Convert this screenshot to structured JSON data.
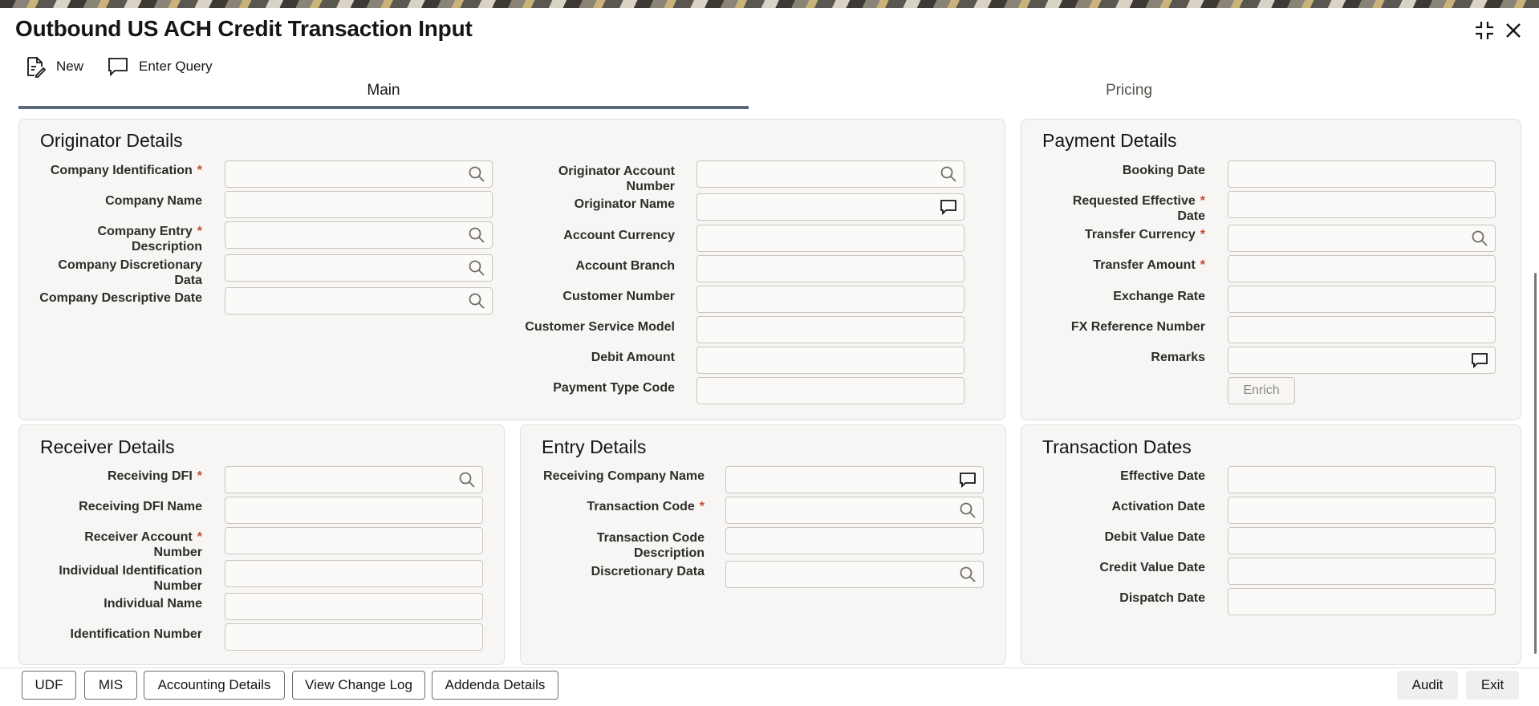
{
  "window": {
    "title": "Outbound US ACH Credit Transaction Input",
    "maximize_icon": "collapse-arrows-icon",
    "close_icon": "close-icon"
  },
  "toolbar": {
    "new_label": "New",
    "enter_query_label": "Enter Query"
  },
  "tabs": [
    {
      "label": "Main",
      "active": true
    },
    {
      "label": "Pricing",
      "active": false
    }
  ],
  "originator": {
    "title": "Originator Details",
    "company_identification": "Company Identification",
    "company_name": "Company Name",
    "company_entry_description_1": "Company Entry",
    "company_entry_description_2": "Description",
    "company_discretionary_data_1": "Company Discretionary",
    "company_discretionary_data_2": "Data",
    "company_descriptive_date": "Company Descriptive Date",
    "originator_account_number_1": "Originator Account",
    "originator_account_number_2": "Number",
    "originator_name": "Originator Name",
    "account_currency": "Account Currency",
    "account_branch": "Account Branch",
    "customer_number": "Customer Number",
    "customer_service_model": "Customer Service Model",
    "debit_amount": "Debit Amount",
    "payment_type_code": "Payment Type Code"
  },
  "payment": {
    "title": "Payment Details",
    "booking_date": "Booking Date",
    "requested_effective_date_1": "Requested Effective",
    "requested_effective_date_2": "Date",
    "transfer_currency": "Transfer Currency",
    "transfer_amount": "Transfer Amount",
    "exchange_rate": "Exchange Rate",
    "fx_reference_number": "FX Reference Number",
    "remarks": "Remarks",
    "enrich_label": "Enrich"
  },
  "receiver": {
    "title": "Receiver Details",
    "receiving_dfi": "Receiving DFI",
    "receiving_dfi_name": "Receiving DFI Name",
    "receiver_account_number_1": "Receiver Account",
    "receiver_account_number_2": "Number",
    "individual_identification_number_1": "Individual Identification",
    "individual_identification_number_2": "Number",
    "individual_name": "Individual Name",
    "identification_number": "Identification Number"
  },
  "entry": {
    "title": "Entry Details",
    "receiving_company_name": "Receiving Company Name",
    "transaction_code": "Transaction Code",
    "transaction_code_description_1": "Transaction Code",
    "transaction_code_description_2": "Description",
    "discretionary_data": "Discretionary Data"
  },
  "dates": {
    "title": "Transaction Dates",
    "effective_date": "Effective Date",
    "activation_date": "Activation Date",
    "debit_value_date": "Debit Value Date",
    "credit_value_date": "Credit Value Date",
    "dispatch_date": "Dispatch Date"
  },
  "required_marker": "*",
  "footer": {
    "udf": "UDF",
    "mis": "MIS",
    "accounting_details": "Accounting Details",
    "view_change_log": "View Change Log",
    "addenda_details": "Addenda Details",
    "audit": "Audit",
    "exit": "Exit"
  },
  "colors": {
    "required": "#c74634",
    "tab_underline": "#5b6b7c",
    "panel_bg": "#f7f6f4"
  }
}
